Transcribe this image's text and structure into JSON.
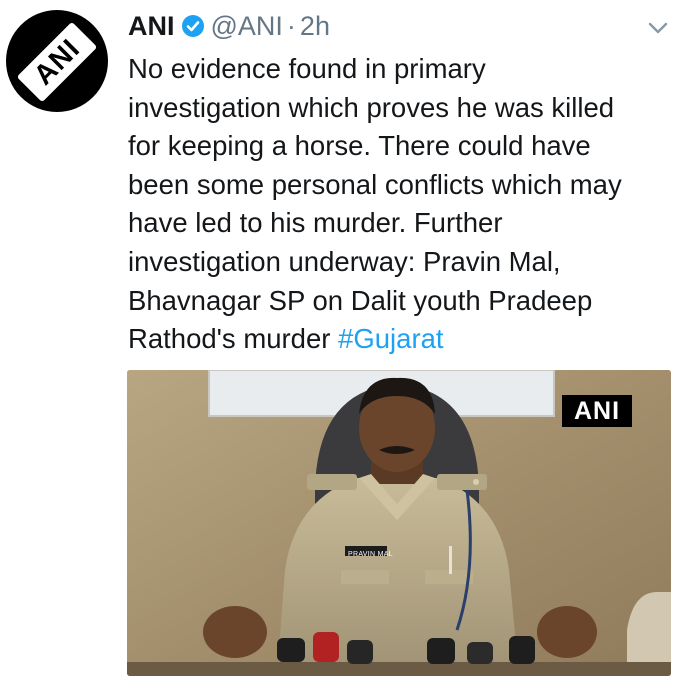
{
  "tweet": {
    "author_name": "ANI",
    "verified": true,
    "handle": "@ANI",
    "separator": "·",
    "time": "2h",
    "avatar_text": "ANI",
    "text_lines": [
      "No evidence found in primary",
      "investigation which proves he was killed",
      "for keeping a horse. There could have",
      "been some personal conflicts which may",
      "have led to his murder. Further",
      "investigation underway: Pravin Mal,",
      "Bhavnagar SP on Dalit youth Pradeep",
      "Rathod's murder "
    ],
    "hashtag": "#Gujarat"
  },
  "media": {
    "watermark": "ANI",
    "name_tag": "PRAVIN MAL"
  },
  "colors": {
    "link": "#1da1f2",
    "verified": "#1da1f2",
    "secondary_text": "#657786",
    "primary_text": "#14171a"
  },
  "icons": {
    "verified": "verified-badge-icon",
    "menu": "chevron-down-icon"
  }
}
